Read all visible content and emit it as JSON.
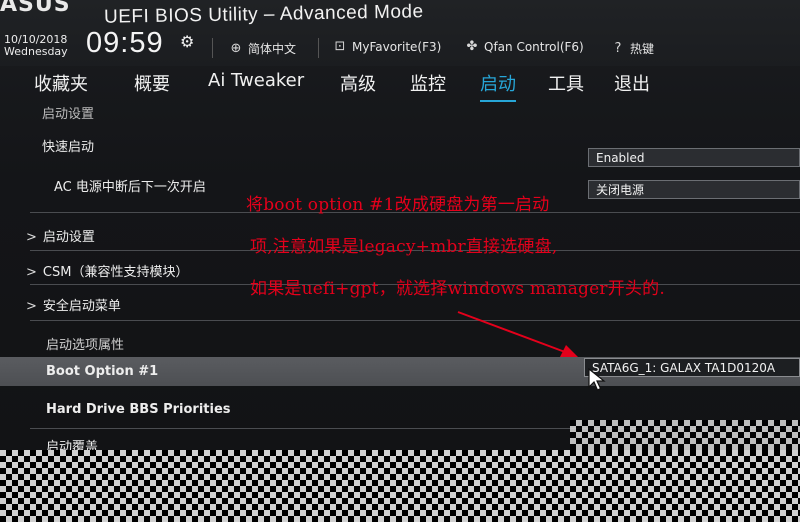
{
  "header": {
    "logo": "ASUS",
    "title": "UEFI BIOS Utility – Advanced Mode",
    "date": "10/10/2018",
    "weekday": "Wednesday",
    "time": "09:59",
    "language": "简体中文",
    "my_favorite": "MyFavorite(F3)",
    "qfan": "Qfan Control(F6)",
    "hotkeys": "热键"
  },
  "tabs": [
    {
      "label": "收藏夹",
      "active": false
    },
    {
      "label": "概要",
      "active": false
    },
    {
      "label": "Ai Tweaker",
      "active": false
    },
    {
      "label": "高级",
      "active": false
    },
    {
      "label": "监控",
      "active": false
    },
    {
      "label": "启动",
      "active": true
    },
    {
      "label": "工具",
      "active": false
    },
    {
      "label": "退出",
      "active": false
    }
  ],
  "content": {
    "path": "启动设置",
    "fast_boot_label": "快速启动",
    "fast_boot_value": "Enabled",
    "ac_power_label": "AC 电源中断后下一次开启",
    "ac_power_value": "关闭电源",
    "submenu_boot_config": "启动设置",
    "submenu_csm": "CSM（兼容性支持模块）",
    "submenu_secure_boot": "安全启动菜单",
    "boot_option_priorities": "启动选项属性",
    "boot_option_1_label": "Boot Option #1",
    "boot_option_1_value": "SATA6G_1: GALAX TA1D0120A",
    "hdd_bbs_label": "Hard Drive BBS Priorities",
    "boot_override_label": "启动覆盖"
  },
  "annotation": {
    "line1": "将boot option #1改成硬盘为第一启动",
    "line2": "项,注意如果是legacy+mbr直接选硬盘,",
    "line3": "如果是uefi+gpt，就选择windows manager开头的."
  },
  "colors": {
    "accent": "#27a6d8",
    "annotation": "#e4001b",
    "highlight_row": "#55575b"
  }
}
